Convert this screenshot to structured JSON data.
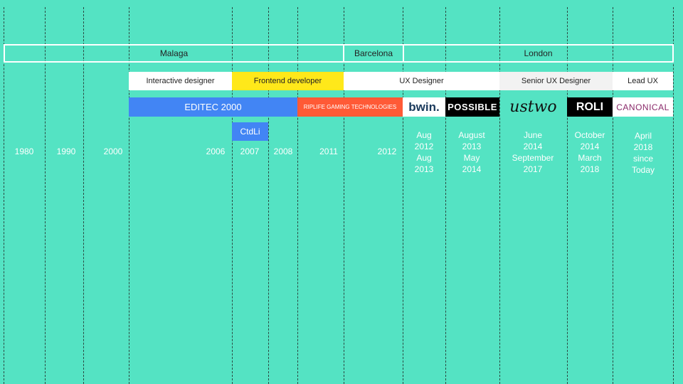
{
  "cities": {
    "malaga": "Malaga",
    "barcelona": "Barcelona",
    "london": "London"
  },
  "roles": {
    "interactive": "Interactive designer",
    "frontend": "Frontend developer",
    "ux": "UX Designer",
    "senior": "Senior UX Designer",
    "lead": "Lead UX"
  },
  "companies": {
    "editec": "EDITEC 2000",
    "ripllife": "RIPLIFE GAMING TECHNOLOGIES",
    "ctdli": "CtdLi",
    "bwin": "bwin.",
    "possible": "POSSIBLE",
    "ustwo": "ustwo",
    "roli": "ROLI",
    "canonical": "CANONICAL"
  },
  "years": {
    "y1980": "1980",
    "y1990": "1990",
    "y2000": "2000",
    "y2006": "2006",
    "y2007": "2007",
    "y2008": "2008",
    "y2011": "2011",
    "y2012": "2012"
  },
  "dates": {
    "bwin": [
      "Aug",
      "2012",
      "Aug",
      "2013"
    ],
    "possible": [
      "August",
      "2013",
      "May",
      "2014"
    ],
    "ustwo": [
      "June",
      "2014",
      "September",
      "2017"
    ],
    "roli": [
      "October",
      "2014",
      "March",
      "2018"
    ],
    "canonical": [
      "April",
      "2018",
      "since",
      "Today"
    ]
  },
  "colors": {
    "background": "#54e3c3",
    "editec": "#4285f4",
    "ripllife": "#ff5a36",
    "frontend": "#ffe81a",
    "senior": "#f2f2f2",
    "canonical": "#8a2a6a"
  }
}
